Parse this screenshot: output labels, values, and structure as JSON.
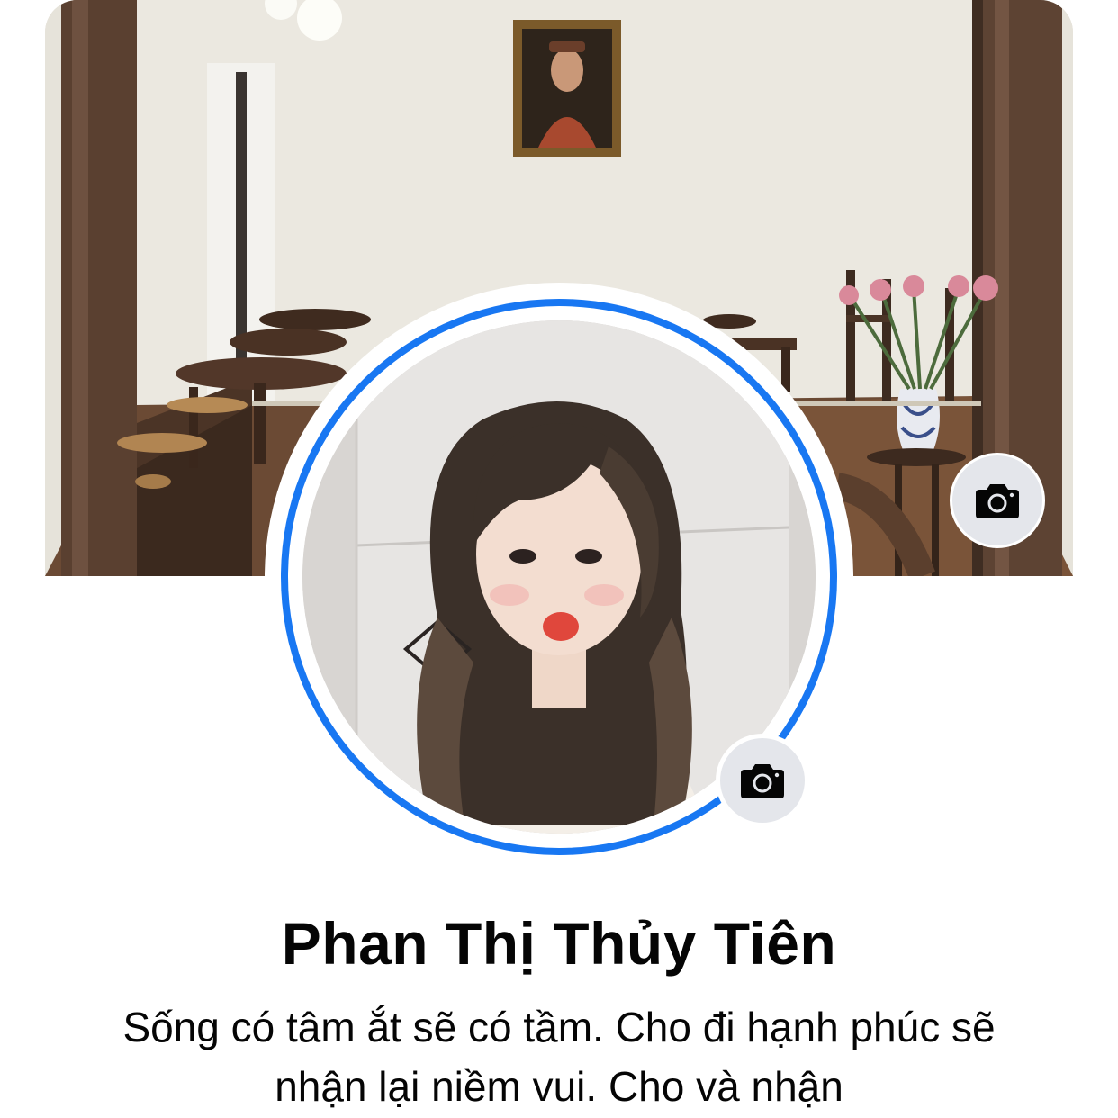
{
  "profile": {
    "name": "Phan Thị Thủy Tiên",
    "bio_line1": "Sống có tâm ắt sẽ có tầm. Cho đi hạnh phúc sẽ",
    "bio_line2": "nhận lại niềm vui. Cho và nhận"
  },
  "icons": {
    "cover_camera": "camera-icon",
    "avatar_camera": "camera-icon"
  },
  "colors": {
    "story_ring": "#1877f2",
    "camera_button_bg": "#e4e6eb",
    "text": "#050505"
  }
}
